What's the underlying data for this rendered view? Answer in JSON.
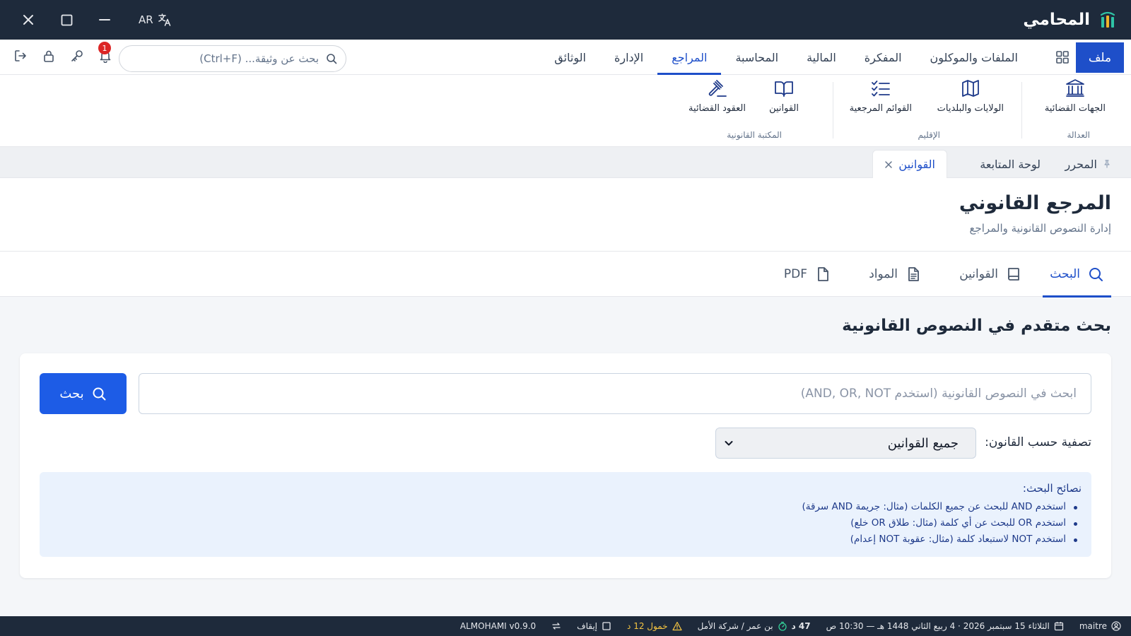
{
  "titlebar": {
    "app_name": "المحامي",
    "lang": "AR",
    "icons": [
      "close-icon",
      "maximize-icon",
      "minimize-icon",
      "translate-icon",
      "logo-icon"
    ]
  },
  "menubar": {
    "file": "ملف",
    "items": [
      "الملفات والموكلون",
      "المفكرة",
      "المالية",
      "المحاسبة",
      "المراجع",
      "الإدارة",
      "الوثائق"
    ],
    "active": "المراجع",
    "doc_search_placeholder": "بحث عن وثيقة... (Ctrl+F)",
    "notifications": "1"
  },
  "ribbon": {
    "groups": [
      {
        "label": "العدالة",
        "buttons": [
          "الجهات القضائية"
        ]
      },
      {
        "label": "الإقليم",
        "buttons": [
          "الولايات والبلديات",
          "القوائم المرجعية"
        ]
      },
      {
        "label": "المكتبة القانونية",
        "buttons": [
          "القوانين",
          "العقود القضائية"
        ]
      }
    ]
  },
  "tabstrip": {
    "tabs": [
      "المحرر",
      "لوحة المتابعة",
      "القوانين"
    ],
    "active": "القوانين"
  },
  "page": {
    "title": "المرجع القانوني",
    "subtitle": "إدارة النصوص القانونية والمراجع"
  },
  "section_tabs": {
    "tabs": [
      "البحث",
      "القوانين",
      "المواد",
      "PDF"
    ],
    "active": "البحث"
  },
  "search": {
    "heading": "بحث متقدم في النصوص القانونية",
    "placeholder": "ابحث في النصوص القانونية (استخدم AND, OR, NOT)",
    "button": "بحث",
    "filter_label": "تصفية حسب القانون:",
    "filter_value": "جميع القوانين",
    "tips_title": "نصائح البحث:",
    "tips": [
      "استخدم AND للبحث عن جميع الكلمات (مثال: جريمة AND سرقة)",
      "استخدم OR للبحث عن أي كلمة (مثال: طلاق OR خلع)",
      "استخدم NOT لاستبعاد كلمة (مثال: عقوبة NOT إعدام)"
    ]
  },
  "statusbar": {
    "user": "maitre",
    "date": "الثلاثاء 15 سبتمبر 2026 · 4 ربيع الثاني 1448 هـ — 10:30 ص",
    "duration": "47 د",
    "client": "بن عمر / شركة الأمل",
    "idle": "خمول 12 د",
    "stop": "إيقاف",
    "version": "ALMOHAMI v0.9.0"
  },
  "colors": {
    "primary": "#1e4fc9",
    "button": "#1d5ce6",
    "titlebar": "#1e2a3b",
    "badge": "#dc2626",
    "warning": "#f5c542",
    "tips_bg": "#eaf2fd"
  }
}
